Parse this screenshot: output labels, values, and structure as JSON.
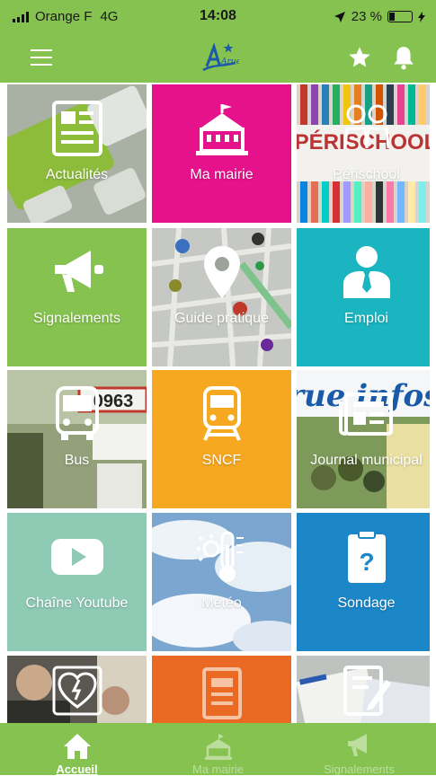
{
  "status_bar": {
    "carrier": "Orange F",
    "network": "4G",
    "time": "14:08",
    "battery": "23 %"
  },
  "nav": {
    "menu_icon": "hamburger-icon",
    "logo_text": "Arue",
    "favorites_icon": "star-icon",
    "notifications_icon": "bell-icon"
  },
  "tiles": [
    {
      "label": "Actualités",
      "icon": "news-icon",
      "bg": "#7a8c6a"
    },
    {
      "label": "Ma mairie",
      "icon": "town-hall-icon",
      "bg": "#e6128c"
    },
    {
      "label": "Périschool",
      "icon": "children-icon",
      "bg": "#b8b8b8",
      "overlay_text": "PÉRISCHOOL"
    },
    {
      "label": "Signalements",
      "icon": "megaphone-icon",
      "bg": "#86c24f"
    },
    {
      "label": "Guide pratique",
      "icon": "map-pin-icon",
      "bg": "#9da39a"
    },
    {
      "label": "Emploi",
      "icon": "employee-icon",
      "bg": "#1ab5c1"
    },
    {
      "label": "Bus",
      "icon": "bus-icon",
      "bg": "#6a7a5a",
      "overlay_text": "0963"
    },
    {
      "label": "SNCF",
      "icon": "train-icon",
      "bg": "#f6a821"
    },
    {
      "label": "Journal municipal",
      "icon": "newspaper-icon",
      "bg": "#6e8a4e",
      "overlay_text": "Arue infos"
    },
    {
      "label": "Chaîne Youtube",
      "icon": "youtube-icon",
      "bg": "#8fcab5"
    },
    {
      "label": "Météo",
      "icon": "thermometer-icon",
      "bg": "#8fb4d6"
    },
    {
      "label": "Sondage",
      "icon": "survey-icon",
      "bg": "#1b87c9"
    },
    {
      "label": "",
      "icon": "defibrillator-icon",
      "bg": "#4a4a44"
    },
    {
      "label": "",
      "icon": "document-icon",
      "bg": "#ea6a24"
    },
    {
      "label": "",
      "icon": "edit-document-icon",
      "bg": "#c9cbc8"
    }
  ],
  "tab_bar": [
    {
      "label": "Accueil",
      "icon": "home-icon",
      "active": true
    },
    {
      "label": "Ma mairie",
      "icon": "town-hall-icon",
      "active": false
    },
    {
      "label": "Signalements",
      "icon": "megaphone-icon",
      "active": false
    }
  ]
}
